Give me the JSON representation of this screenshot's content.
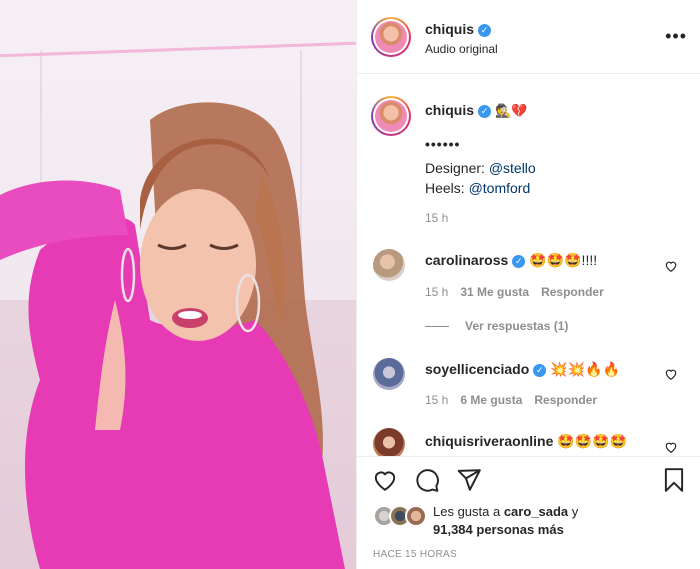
{
  "header": {
    "username": "chiquis",
    "audio": "Audio original",
    "more_icon": "more-horizontal-icon"
  },
  "caption": {
    "username": "chiquis",
    "emojis": "🕵💔",
    "dots": "••••••",
    "line1_prefix": "Designer: ",
    "line1_mention": "@stello",
    "line2_prefix": "Heels: ",
    "line2_mention": "@tomford",
    "time": "15 h"
  },
  "comments": [
    {
      "username": "carolinaross",
      "text": "🤩🤩🤩!!!!",
      "time": "15 h",
      "likes": "31 Me gusta",
      "reply": "Responder",
      "view_replies": "Ver respuestas (1)"
    },
    {
      "username": "soyellicenciado",
      "text": "💥💥🔥🔥",
      "time": "15 h",
      "likes": "6 Me gusta",
      "reply": "Responder"
    },
    {
      "username": "chiquisriveraonline",
      "text": "🤩🤩🤩🤩"
    }
  ],
  "actions": {
    "like_icon": "heart-icon",
    "comment_icon": "comment-icon",
    "share_icon": "send-icon",
    "save_icon": "bookmark-icon"
  },
  "likes": {
    "prefix": "Les gusta a ",
    "user": "caro_sada",
    "connector": " y",
    "count": "91,384 personas más"
  },
  "timestamp": "HACE 15 HORAS",
  "colors": {
    "accent_blue": "#3897f0",
    "mention": "#00376b",
    "muted": "#8e8e8e",
    "dress_pink": "#e63bb5"
  }
}
